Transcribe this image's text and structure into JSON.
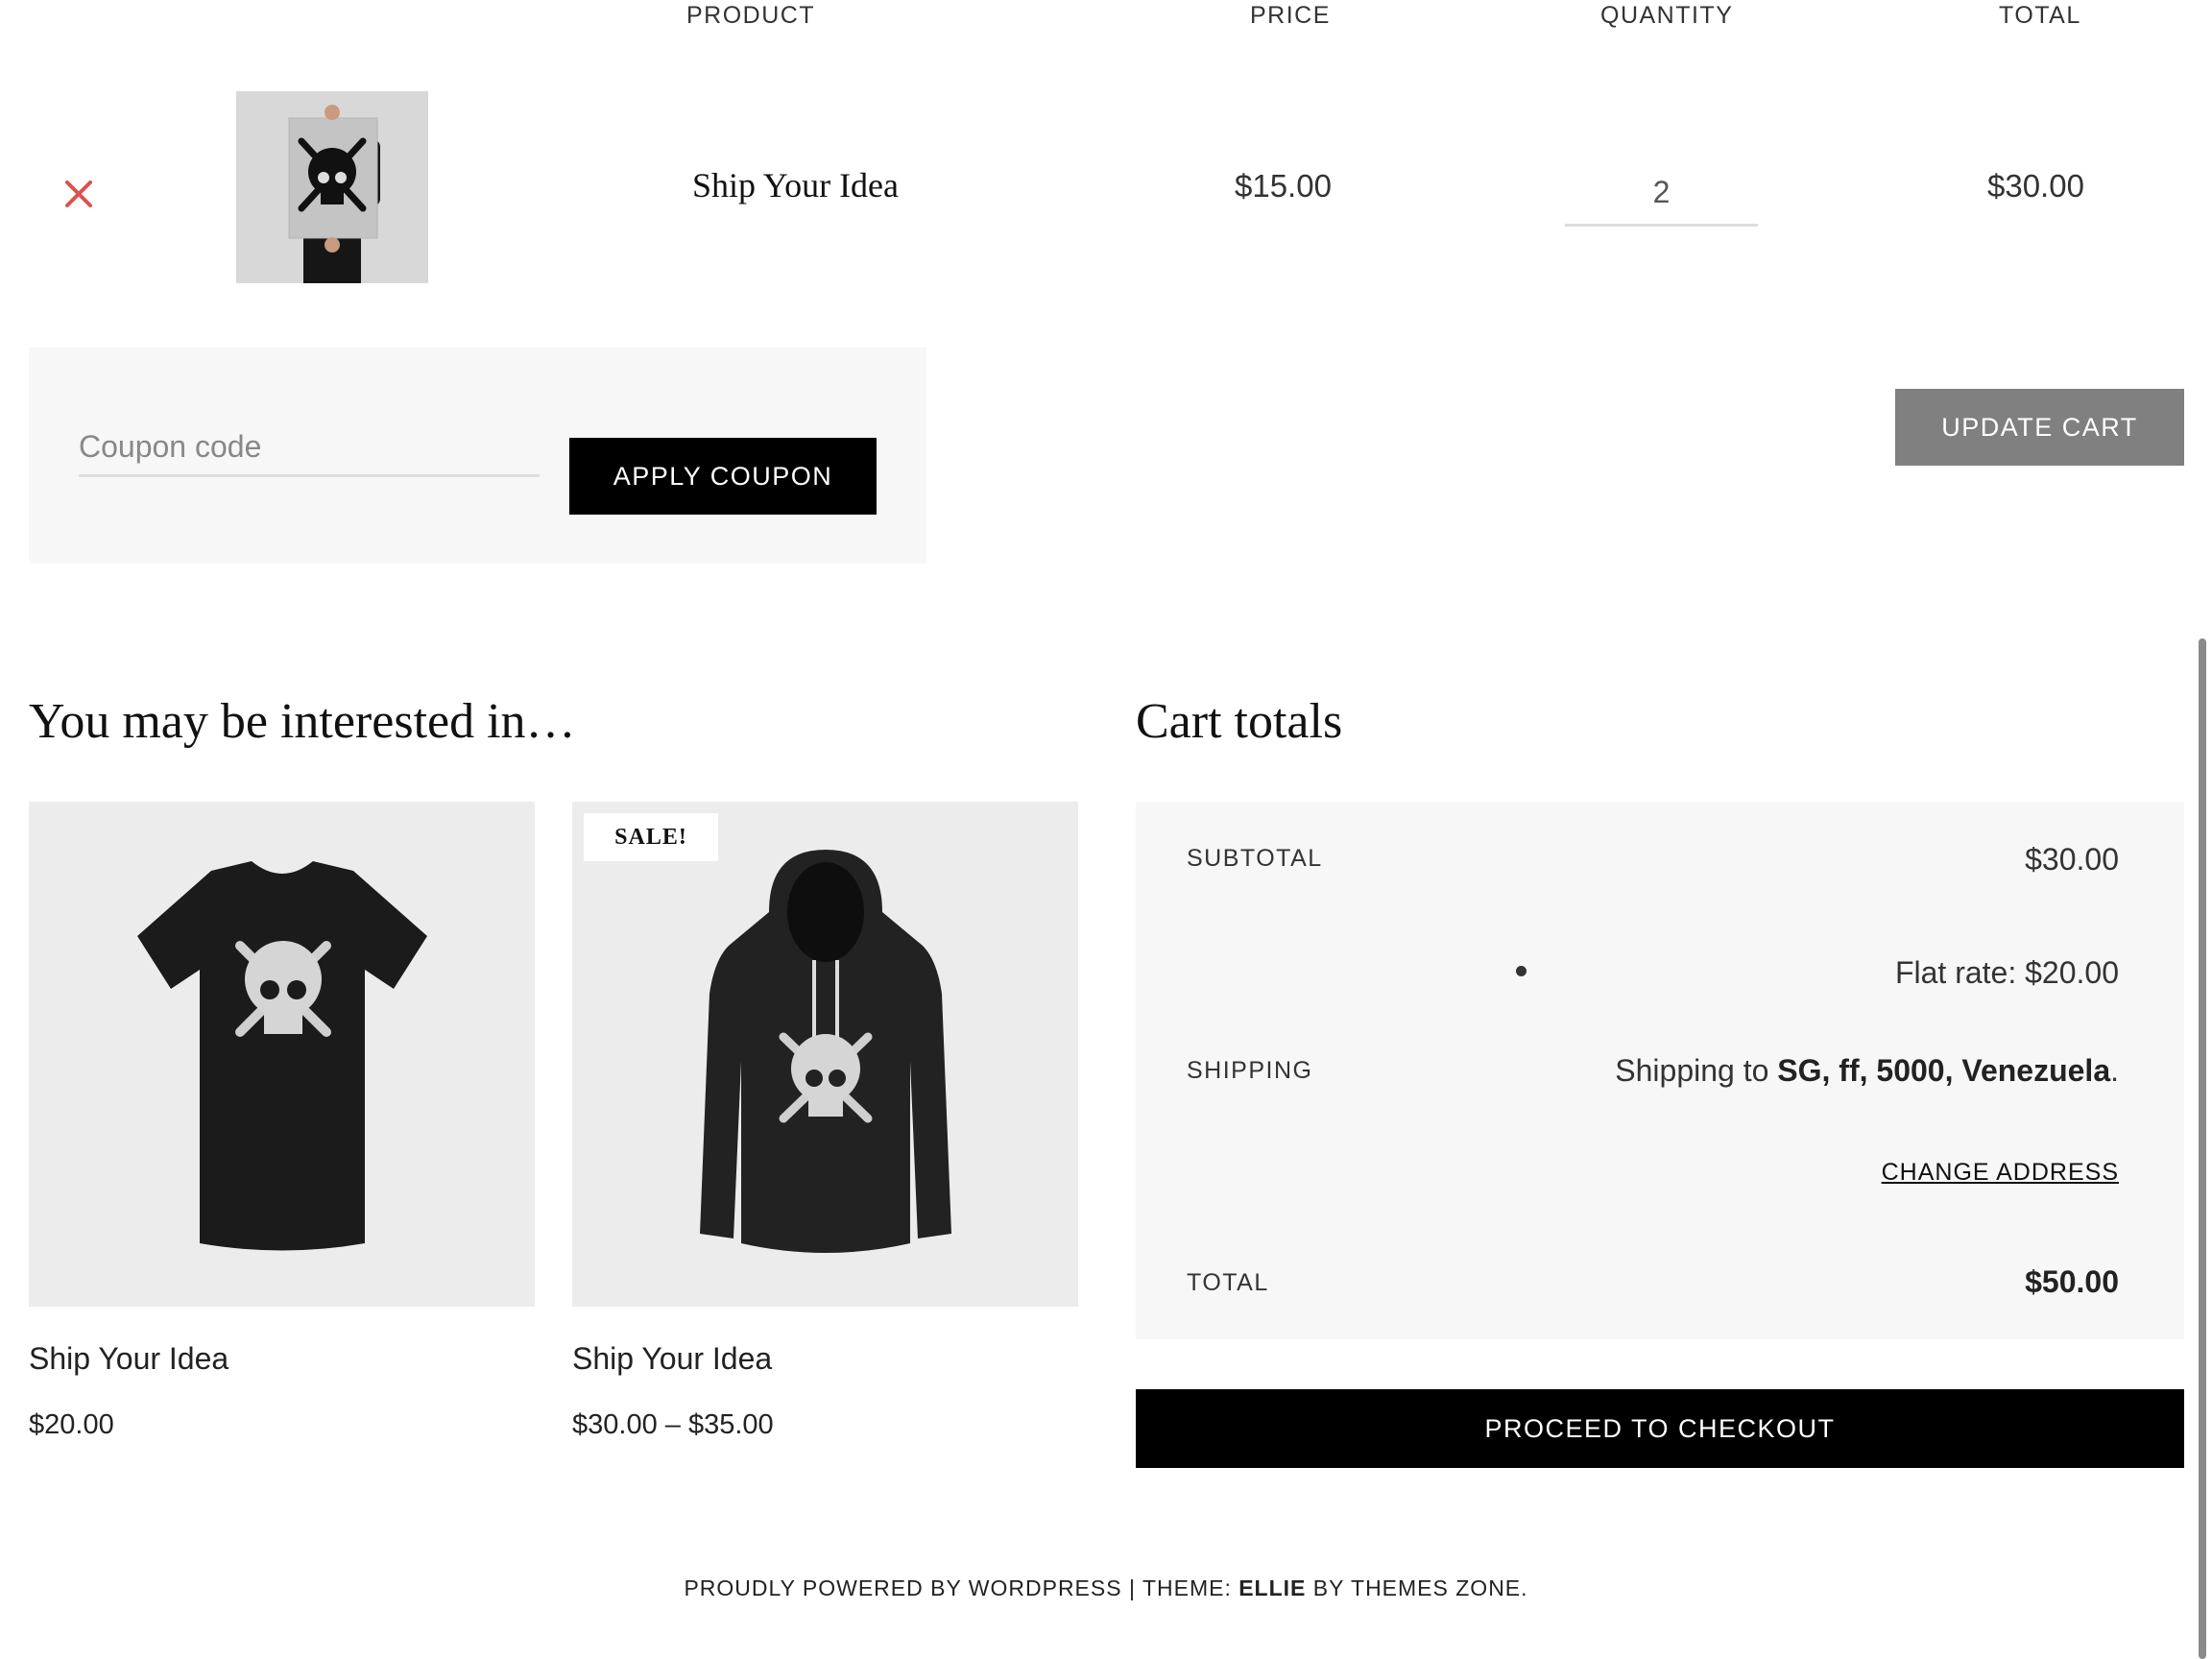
{
  "cart_table": {
    "headers": {
      "product": "PRODUCT",
      "price": "PRICE",
      "quantity": "QUANTITY",
      "total": "TOTAL"
    },
    "rows": [
      {
        "name": "Ship Your Idea",
        "price": "$15.00",
        "quantity": "2",
        "total": "$30.00",
        "thumbnail_alt": "Ship Your Idea poster"
      }
    ]
  },
  "coupon": {
    "placeholder": "Coupon code",
    "apply_label": "APPLY COUPON"
  },
  "update_cart_label": "UPDATE CART",
  "cross_sells": {
    "heading": "You may be interested in…",
    "items": [
      {
        "title": "Ship Your Idea",
        "price": "$20.00",
        "badge": "",
        "image": "tshirt"
      },
      {
        "title": "Ship Your Idea",
        "price": "$30.00 – $35.00",
        "badge": "SALE!",
        "image": "hoodie"
      }
    ]
  },
  "cart_totals": {
    "heading": "Cart totals",
    "subtotal_label": "SUBTOTAL",
    "subtotal_value": "$30.00",
    "shipping_label": "SHIPPING",
    "flat_rate": "Flat rate: $20.00",
    "shipping_to_prefix": "Shipping to",
    "shipping_to_address": "SG, ff, 5000, Venezuela",
    "shipping_to_suffix": ".",
    "change_address_label": "CHANGE ADDRESS",
    "total_label": "TOTAL",
    "total_value": "$50.00",
    "checkout_label": "PROCEED TO CHECKOUT"
  },
  "footer": {
    "powered": "PROUDLY POWERED BY WORDPRESS",
    "separator": "|",
    "theme_prefix": "THEME:",
    "theme_name": "ELLIE",
    "theme_suffix": "BY THEMES ZONE."
  },
  "colors": {
    "remove_icon": "#d9534f",
    "button_black": "#000000",
    "button_grey": "#808080",
    "panel_bg": "#f7f7f7"
  }
}
